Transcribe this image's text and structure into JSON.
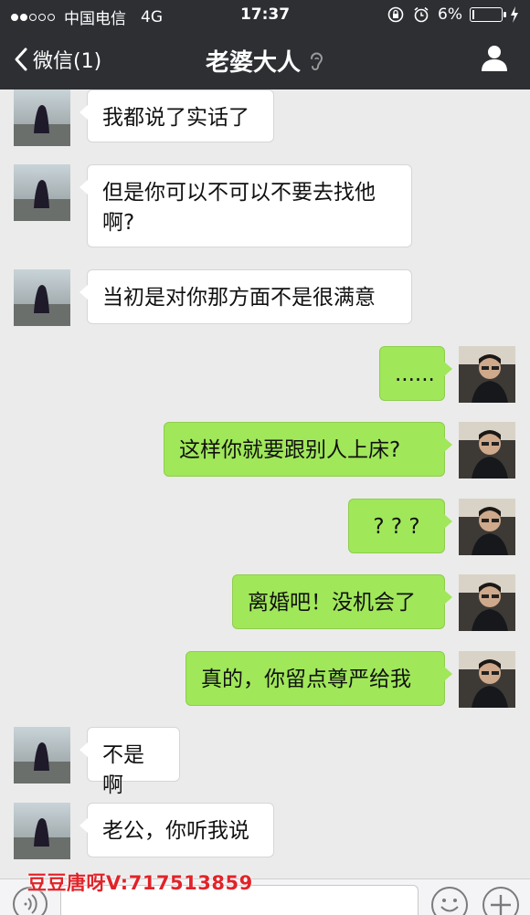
{
  "status": {
    "carrier": "中国电信",
    "network": "4G",
    "time": "17:37",
    "battery": "6%",
    "battery_level": 0.06,
    "signal_filled": 2,
    "signal_total": 5
  },
  "nav": {
    "back_label": "微信(1)",
    "title": "老婆大人"
  },
  "messages": [
    {
      "side": "in",
      "text": "我都说了实话了"
    },
    {
      "side": "in",
      "text": "但是你可以不可以不要去找他啊?"
    },
    {
      "side": "in",
      "text": "当初是对你那方面不是很满意"
    },
    {
      "side": "out",
      "text": "......"
    },
    {
      "side": "out",
      "text": "这样你就要跟别人上床?"
    },
    {
      "side": "out",
      "text": "? ? ?"
    },
    {
      "side": "out",
      "text": "离婚吧！没机会了"
    },
    {
      "side": "out",
      "text": "真的，你留点尊严给我"
    },
    {
      "side": "in",
      "text": "不是啊"
    },
    {
      "side": "in",
      "text": "老公，你听我说"
    }
  ],
  "watermark": "豆豆唐呀V:717513859",
  "colors": {
    "header": "#2d2f33",
    "chat_bg": "#ebebeb",
    "out_bubble": "#a0e75a",
    "in_bubble": "#ffffff",
    "watermark": "#e0242a"
  },
  "icons": {
    "back": "chevron-left-icon",
    "mute": "ear-icon",
    "profile": "person-icon",
    "voice": "voice-icon",
    "emoji": "smiley-icon",
    "more": "plus-icon"
  }
}
